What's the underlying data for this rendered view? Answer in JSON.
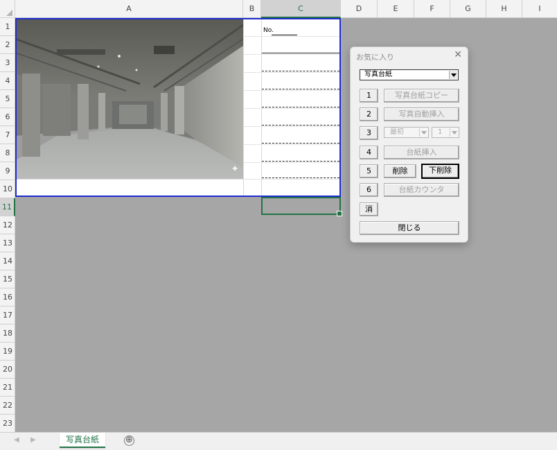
{
  "columns": [
    "A",
    "B",
    "C",
    "D",
    "E",
    "F",
    "G",
    "H",
    "I"
  ],
  "rows": [
    "1",
    "2",
    "3",
    "4",
    "5",
    "6",
    "7",
    "8",
    "9",
    "10",
    "11",
    "12",
    "13",
    "14",
    "15",
    "16",
    "17",
    "18",
    "19",
    "20",
    "21",
    "22",
    "23"
  ],
  "selected_cell": {
    "column": "C",
    "row": "11"
  },
  "cells": {
    "c1_label": "No."
  },
  "sheet_tabs": [
    {
      "label": "写真台紙",
      "active": true
    }
  ],
  "dialog": {
    "title": "お気に入り",
    "close_glyph": "✕",
    "dropdown_value": "写真台紙",
    "rows": [
      {
        "num": "1",
        "action": "写真台紙コピー"
      },
      {
        "num": "2",
        "action": "写真自動挿入"
      },
      {
        "num": "3",
        "combo_start": "最初",
        "combo_count": "1"
      },
      {
        "num": "4",
        "action": "台紙挿入"
      },
      {
        "num": "5",
        "delete": "削除",
        "delete_below": "下削除"
      },
      {
        "num": "6",
        "action": "台紙カウンタ"
      }
    ],
    "clear_label": "消",
    "close_label": "閉じる"
  },
  "colors": {
    "accent": "#217346",
    "print_frame": "#1e2bd0",
    "grey_area": "#a6a6a6"
  },
  "icons": {
    "add_sheet": "⊕",
    "nav_prev": "◀",
    "nav_next": "▶",
    "sparkle": "✦"
  }
}
